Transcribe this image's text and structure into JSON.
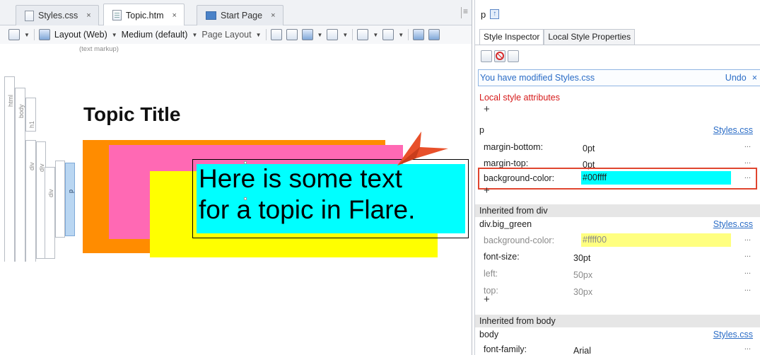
{
  "editor": {
    "tabs": [
      {
        "label": "Styles.css",
        "close": "×"
      },
      {
        "label": "Topic.htm",
        "close": "×"
      },
      {
        "label": "Start Page",
        "close": "×"
      }
    ],
    "toolbar": {
      "layout_label": "Layout (Web)",
      "medium_label": "Medium (default)",
      "page_layout_label": "Page Layout"
    },
    "text_markup_label": "(text markup)",
    "structure_labels": {
      "html": "html",
      "body": "body",
      "h1": "h1",
      "div1": "div",
      "div2": "div",
      "div3": "div",
      "p": "p"
    },
    "topic_title": "Topic Title",
    "body_text_line1": "Here is some text",
    "body_text_line2": "for a topic in Flare.",
    "colors": {
      "orange": "#ff8c00",
      "pink": "#ff69b4",
      "yellow": "#ffff00",
      "cyan": "#00ffff",
      "callout": "#e8502a"
    }
  },
  "inspector": {
    "element_label": "p",
    "tabs": {
      "style_inspector": "Style Inspector",
      "local_style_properties": "Local Style Properties"
    },
    "modified_notice": "You have modified Styles.css",
    "undo_label": "Undo",
    "close_label": "×",
    "local_attrs_label": "Local style attributes",
    "plus": "+",
    "p_section": {
      "selector": "p",
      "source": "Styles.css",
      "props": [
        {
          "name": "margin-bottom:",
          "value": "0pt",
          "more": "..."
        },
        {
          "name": "margin-top:",
          "value": "0pt",
          "more": "..."
        },
        {
          "name": "background-color:",
          "value": "#00ffff",
          "more": "..."
        }
      ]
    },
    "div_section": {
      "header": "Inherited from div",
      "selector": "div.big_green",
      "source": "Styles.css",
      "props": [
        {
          "name": "background-color:",
          "value": "#ffff00",
          "more": "..."
        },
        {
          "name": "font-size:",
          "value": "30pt",
          "more": "..."
        },
        {
          "name": "left:",
          "value": "50px",
          "more": "..."
        },
        {
          "name": "top:",
          "value": "30px",
          "more": "..."
        }
      ]
    },
    "body_section": {
      "header": "Inherited from body",
      "selector": "body",
      "source": "Styles.css",
      "props": [
        {
          "name": "font-family:",
          "value": "Arial",
          "more": "..."
        }
      ]
    },
    "colors": {
      "link": "#2a6cc6",
      "highlight_border": "#e0452f",
      "cyan_swatch": "#00ffff",
      "yellow_swatch": "#ffff80"
    }
  }
}
